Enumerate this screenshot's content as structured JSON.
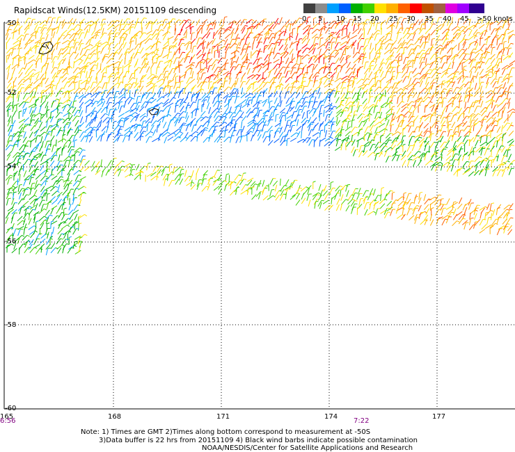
{
  "title": "Rapidscat Winds(12.5KM) 20151109 descending",
  "legend": {
    "colors": [
      "#404040",
      "#8c8c8c",
      "#00a0ff",
      "#0060ff",
      "#00b000",
      "#40d000",
      "#ffe000",
      "#ffb000",
      "#ff6000",
      "#ff0000",
      "#c05000",
      "#a06040",
      "#e000e0",
      "#a000ff",
      "#300090"
    ],
    "labels": [
      "0",
      "5",
      "10",
      "15",
      "20",
      "25",
      "30",
      "35",
      "40",
      "45",
      ">50 knots"
    ]
  },
  "grid": {
    "lat_labels": [
      "-50",
      "-52",
      "-54",
      "-56",
      "-58",
      "-60"
    ],
    "lon_labels": [
      "165",
      "168",
      "171",
      "174",
      "177"
    ]
  },
  "times": [
    "6:56",
    "7:22"
  ],
  "notes": [
    "Note: 1) Times are GMT 2)Times along bottom correspond to measurement at -50S",
    "3)Data buffer is 22 hrs from 20151109 4) Black wind barbs indicate possible contamination",
    "NOAA/NESDIS/Center for Satellite Applications and Research"
  ]
}
